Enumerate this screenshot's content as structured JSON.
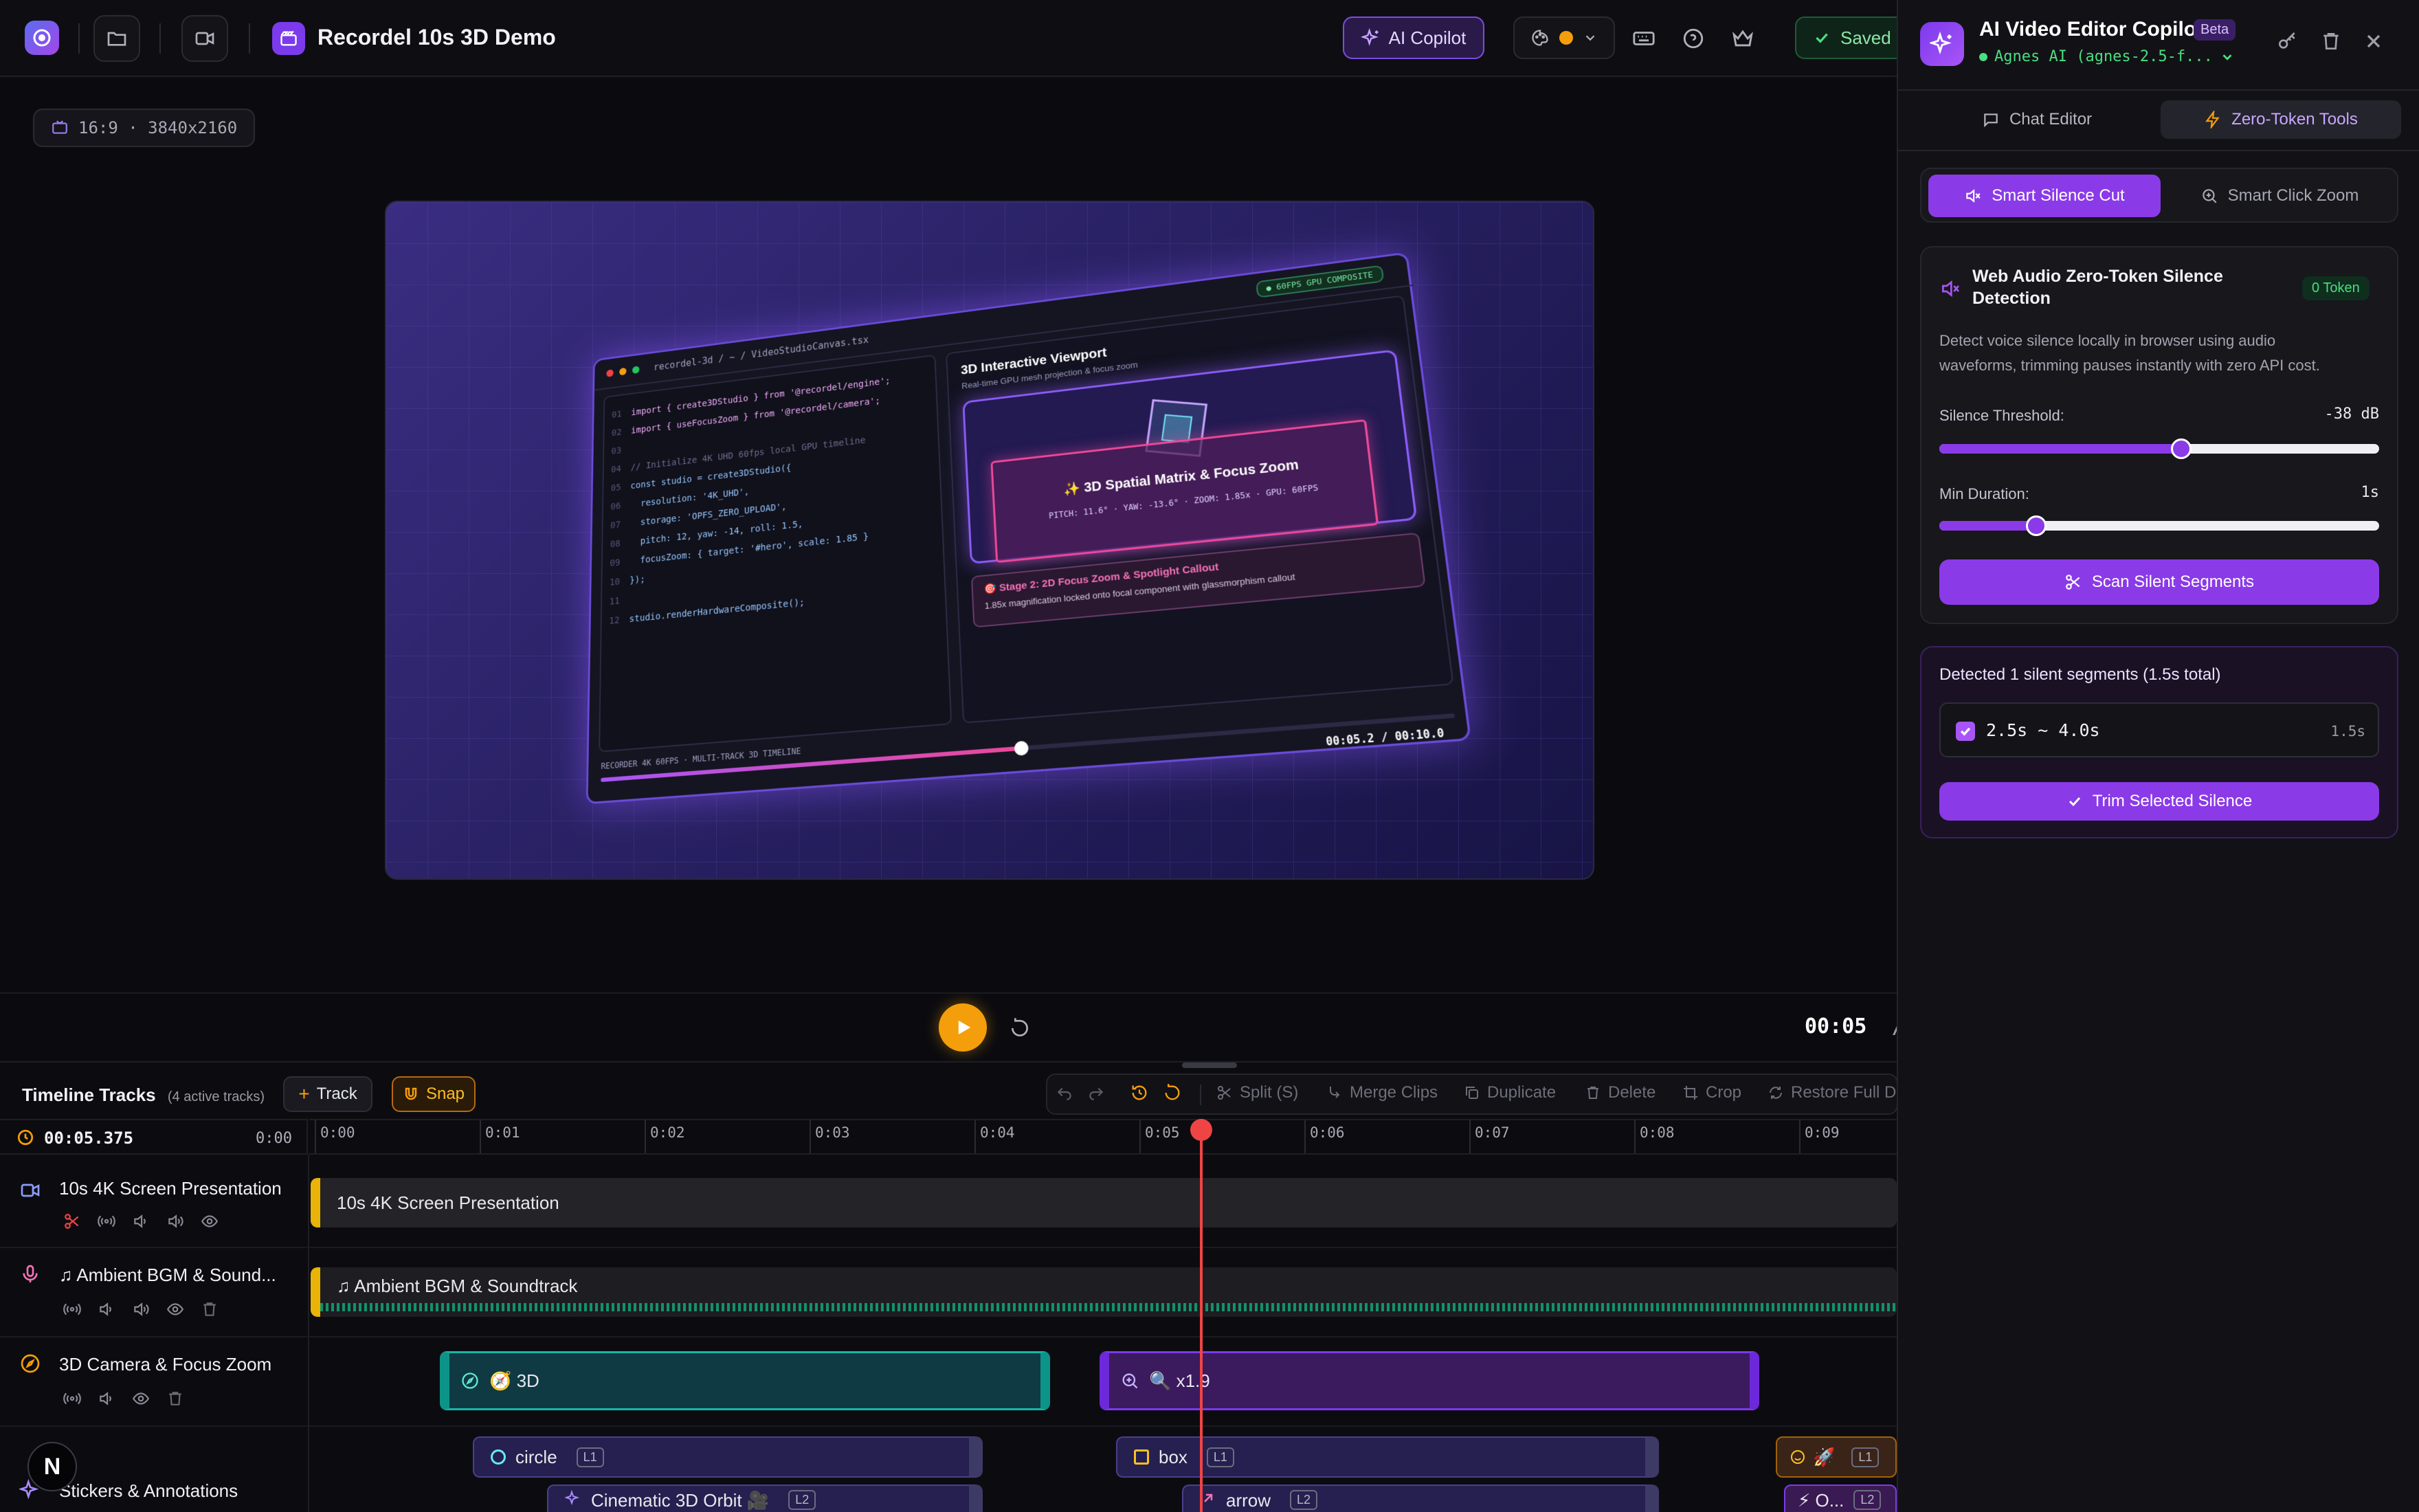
{
  "header": {
    "project_title": "Recordel 10s 3D Demo",
    "ai_copilot_label": "AI Copilot",
    "saved_label": "Saved"
  },
  "preview": {
    "aspect_ratio": "16:9 · 3840x2160",
    "editor": {
      "file_path": "recordel-3d / ~ / VideoStudioCanvas.tsx",
      "gpu_badge": "● 60FPS GPU COMPOSITE",
      "code_lines": [
        {
          "n": "01",
          "t": "import { create3DStudio } from '@recordel/engine';"
        },
        {
          "n": "02",
          "t": "import { useFocusZoom } from '@recordel/camera';"
        },
        {
          "n": "03",
          "t": ""
        },
        {
          "n": "04",
          "t": "// Initialize 4K UHD 60fps local GPU timeline"
        },
        {
          "n": "05",
          "t": "const studio = create3DStudio({"
        },
        {
          "n": "06",
          "t": "  resolution: '4K_UHD',"
        },
        {
          "n": "07",
          "t": "  storage: 'OPFS_ZERO_UPLOAD',"
        },
        {
          "n": "08",
          "t": "  pitch: 12, yaw: -14, roll: 1.5,"
        },
        {
          "n": "09",
          "t": "  focusZoom: { target: '#hero', scale: 1.85 }"
        },
        {
          "n": "10",
          "t": "});"
        },
        {
          "n": "11",
          "t": ""
        },
        {
          "n": "12",
          "t": "studio.renderHardwareComposite();"
        }
      ],
      "viewport_title": "3D Interactive Viewport",
      "viewport_subtitle": "Real-time GPU mesh projection & focus zoom",
      "matrix_title": "✨ 3D Spatial Matrix & Focus Zoom",
      "matrix_stats": "PITCH: 11.6° · YAW: -13.6° · ZOOM: 1.85x · GPU: 60FPS",
      "stage_title": "🎯 Stage 2: 2D Focus Zoom & Spotlight Callout",
      "stage_desc": "1.85x magnification locked onto focal component with glassmorphism callout",
      "footer_label": "RECORDER 4K 60FPS · MULTI-TRACK 3D TIMELINE",
      "footer_time": "00:05.2 / 00:10.0",
      "progress": 0.52
    }
  },
  "controls": {
    "current_time": "00:05",
    "time_separator": "/",
    "total_time_partial": "0"
  },
  "timeline": {
    "title": "Timeline Tracks",
    "active_tracks": "(4 active tracks)",
    "add_track_label": "Track",
    "snap_label": "Snap",
    "toolbar": {
      "split": "Split (S)",
      "merge": "Merge Clips",
      "duplicate": "Duplicate",
      "delete": "Delete",
      "crop": "Crop",
      "restore": "Restore Full Du"
    },
    "playhead_time": "00:05.375",
    "ruler_start": "0:00",
    "ruler_ticks": [
      "0:00",
      "0:01",
      "0:02",
      "0:03",
      "0:04",
      "0:05",
      "0:06",
      "0:07",
      "0:08",
      "0:09"
    ],
    "playhead_seconds": 5.375,
    "tracks": [
      {
        "name": "10s 4K Screen Presentation"
      },
      {
        "name": "♫ Ambient BGM & Sound..."
      },
      {
        "name": "3D Camera & Focus Zoom"
      },
      {
        "name": "Stickers & Annotations"
      }
    ],
    "clips": {
      "screen": "10s 4K Screen Presentation",
      "bgm": "♫ Ambient BGM & Soundtrack",
      "cam_3d": "🧭 3D",
      "cam_zoom": "🔍 x1.9",
      "circle": "circle",
      "circle_layer": "L1",
      "orbit": "Cinematic 3D Orbit 🎥",
      "orbit_layer": "L2",
      "box": "box",
      "box_layer": "L1",
      "arrow": "arrow",
      "arrow_layer": "L2",
      "rocket": "🚀",
      "rocket_layer": "L1",
      "o_clip": "⚡ O...",
      "o_layer": "L2"
    },
    "avatar_letter": "N"
  },
  "copilot": {
    "title": "AI Video Editor Copilot",
    "beta": "Beta",
    "model": "Agnes AI (agnes-2.5-f...",
    "tabs": {
      "chat": "Chat Editor",
      "tools": "Zero-Token Tools"
    },
    "subtabs": {
      "silence": "Smart Silence Cut",
      "zoom": "Smart Click Zoom"
    },
    "silence_card": {
      "title_line1": "Web Audio Zero-Token Silence",
      "title_line2": "Detection",
      "token_badge": "0 Token",
      "desc_line1": "Detect voice silence locally in browser using audio",
      "desc_line2": "waveforms, trimming pauses instantly with zero API cost.",
      "threshold_label": "Silence Threshold:",
      "threshold_value": "-38 dB",
      "threshold_fraction": 0.55,
      "duration_label": "Min Duration:",
      "duration_value": "1s",
      "duration_fraction": 0.22,
      "scan_label": "Scan Silent Segments"
    },
    "results": {
      "summary": "Detected 1 silent segments (1.5s total)",
      "segment_range": "2.5s ~ 4.0s",
      "segment_len": "1.5s",
      "trim_label": "Trim Selected Silence"
    }
  }
}
